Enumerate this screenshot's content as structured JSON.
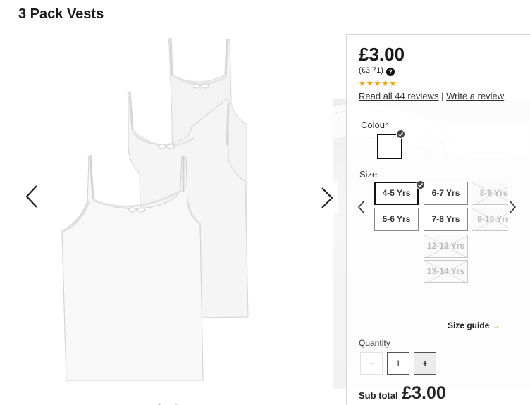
{
  "product": {
    "title": "3 Pack Vests"
  },
  "gallery": {
    "image_name": "three-white-vests",
    "prev_icon": "chevron-left-icon",
    "next_icon": "chevron-right-icon"
  },
  "pricing": {
    "price": "£3.00",
    "alt_price": "(€3.71)",
    "help_glyph": "?",
    "rating": 4.5,
    "stars": "★★★★★",
    "reviews_link": "Read all 44 reviews",
    "separator": " | ",
    "write_review": "Write a review"
  },
  "colour": {
    "label": "Colour",
    "selected": "White"
  },
  "size": {
    "label": "Size",
    "options": [
      {
        "label": "4-5 Yrs",
        "state": "selected"
      },
      {
        "label": "6-7 Yrs",
        "state": "available"
      },
      {
        "label": "8-9 Yrs",
        "state": "unavailable"
      },
      {
        "label": "5-6 Yrs",
        "state": "available"
      },
      {
        "label": "7-8 Yrs",
        "state": "available"
      },
      {
        "label": "9-10 Yrs",
        "state": "unavailable"
      },
      {
        "label": "12-13 Yrs",
        "state": "unavailable"
      },
      {
        "label": "13-14 Yrs",
        "state": "unavailable"
      }
    ],
    "guide": "Size guide",
    "guide_arrow": "→"
  },
  "quantity": {
    "label": "Quantity",
    "minus": "-",
    "value": "1",
    "plus": "+"
  },
  "subtotal": {
    "label": "Sub total",
    "amount": "£3.00"
  },
  "colors": {
    "accent": "#f0a500",
    "text": "#222222",
    "border": "#888888"
  }
}
